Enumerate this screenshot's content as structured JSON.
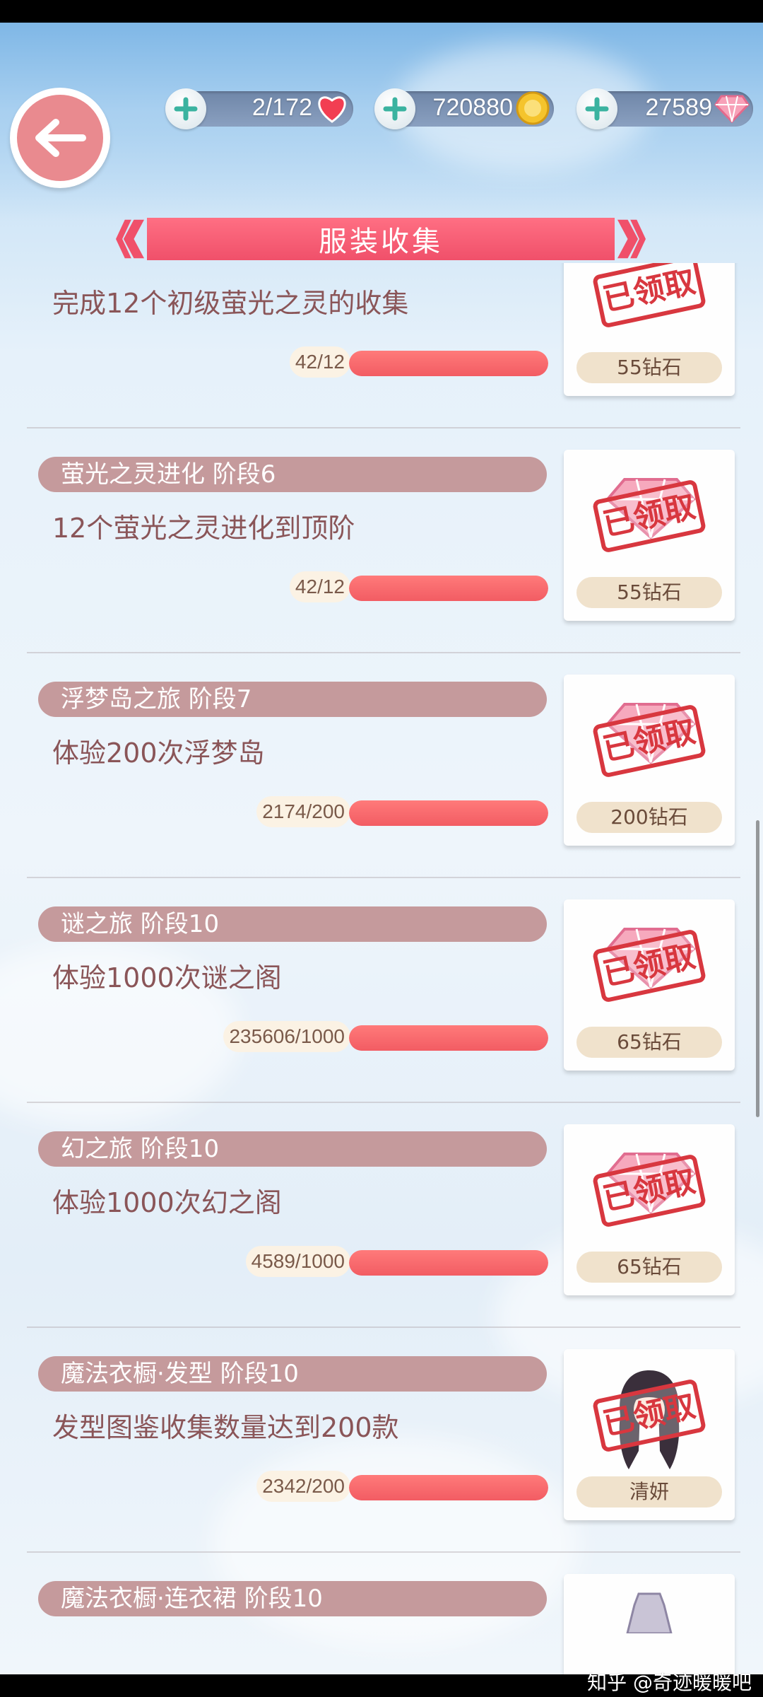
{
  "header": {
    "back_icon": "back-arrow-icon",
    "resources": [
      {
        "name": "stamina",
        "value": "2/172",
        "icon": "heart-icon"
      },
      {
        "name": "gold",
        "value": "720880",
        "icon": "gold-coin-icon"
      },
      {
        "name": "diamond",
        "value": "27589",
        "icon": "diamond-icon"
      }
    ]
  },
  "banner": {
    "title": "服装收集"
  },
  "colors": {
    "accent": "#f0506a",
    "pill": "#c59a9c",
    "stamp": "#d8373f",
    "bar_fill": "#f25c63"
  },
  "tasks": [
    {
      "title": "",
      "desc": "完成12个初级萤光之灵的收集",
      "progress": "42/12",
      "fill_fraction": 1.0,
      "reward": "55钻石",
      "stamp": "已领取",
      "reward_icon": "diamond-icon"
    },
    {
      "title": "萤光之灵进化 阶段6",
      "desc": "12个萤光之灵进化到顶阶",
      "progress": "42/12",
      "fill_fraction": 1.0,
      "reward": "55钻石",
      "stamp": "已领取",
      "reward_icon": "diamond-icon"
    },
    {
      "title": "浮梦岛之旅 阶段7",
      "desc": "体验200次浮梦岛",
      "progress": "2174/200",
      "fill_fraction": 1.0,
      "reward": "200钻石",
      "stamp": "已领取",
      "reward_icon": "diamond-icon"
    },
    {
      "title": "谜之旅 阶段10",
      "desc": "体验1000次谜之阁",
      "progress": "235606/1000",
      "fill_fraction": 1.0,
      "reward": "65钻石",
      "stamp": "已领取",
      "reward_icon": "diamond-icon"
    },
    {
      "title": "幻之旅 阶段10",
      "desc": "体验1000次幻之阁",
      "progress": "4589/1000",
      "fill_fraction": 1.0,
      "reward": "65钻石",
      "stamp": "已领取",
      "reward_icon": "diamond-icon"
    },
    {
      "title": "魔法衣橱·发型 阶段10",
      "desc": "发型图鉴收集数量达到200款",
      "progress": "2342/200",
      "fill_fraction": 1.0,
      "reward": "清妍",
      "stamp": "已领取",
      "reward_icon": "hairstyle-icon"
    },
    {
      "title": "魔法衣橱·连衣裙 阶段10",
      "desc": "",
      "progress": "",
      "fill_fraction": 0,
      "reward": "",
      "stamp": "",
      "reward_icon": "dress-icon"
    }
  ],
  "watermark": "知乎 @奇迹暖暖吧"
}
